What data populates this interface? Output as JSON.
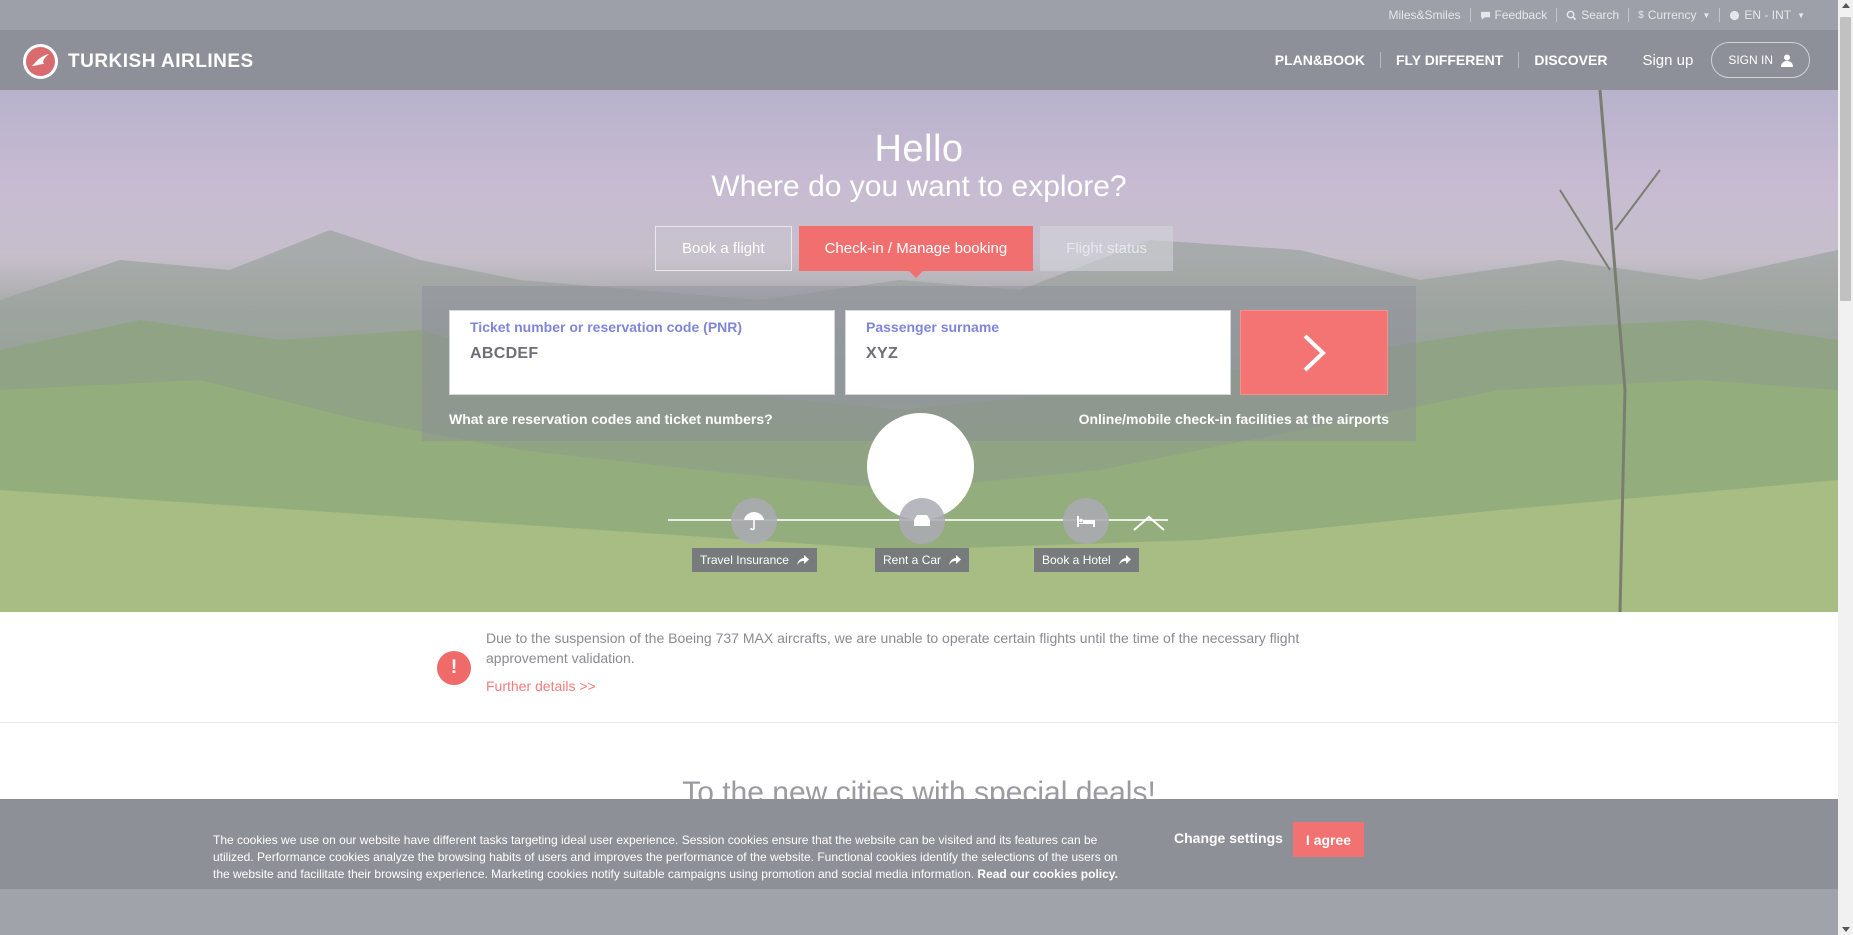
{
  "utility_bar": {
    "miles": "Miles&Smiles",
    "feedback": "Feedback",
    "search": "Search",
    "currency": "Currency",
    "language": "EN - INT"
  },
  "header": {
    "brand": "TURKISH AIRLINES",
    "nav": [
      "PLAN&BOOK",
      "FLY DIFFERENT",
      "DISCOVER"
    ],
    "signup": "Sign up",
    "signin": "SIGN IN"
  },
  "hero": {
    "title": "Hello",
    "subtitle": "Where do you want to explore?",
    "tabs": {
      "book": "Book a flight",
      "checkin": "Check-in / Manage booking",
      "status": "Flight status"
    },
    "active_tab": "checkin",
    "form": {
      "pnr_label": "Ticket number or reservation code (PNR)",
      "pnr_value": "ABCDEF",
      "surname_label": "Passenger surname",
      "surname_value": "XYZ"
    },
    "help_left": "What are reservation codes and ticket numbers?",
    "help_right": "Online/mobile check-in facilities at the airports",
    "services": {
      "insurance": "Travel Insurance",
      "car": "Rent a Car",
      "hotel": "Book a Hotel"
    }
  },
  "notice": {
    "icon": "!",
    "text": "Due to the suspension of the Boeing 737 MAX aircrafts, we are unable to operate certain flights until the time of the necessary flight approvement validation.",
    "link": "Further details >>"
  },
  "section_title": "To the new cities with special deals!",
  "cookie": {
    "text": "The cookies we use on our website have different tasks targeting ideal user experience. Session cookies ensure that the website can be visited and its features can be utilized. Performance cookies analyze the browsing habits of users and improves the performance of the website. Functional cookies identify the selections of the users on the website and facilitate their browsing experience. Marketing cookies notify suitable campaigns using promotion and social media information.",
    "policy_link": "Read our cookies policy.",
    "change_settings": "Change settings",
    "agree": "I agree"
  },
  "colors": {
    "brand_red": "#f26f6f",
    "field_label": "#7f86d9",
    "overlay": "#8e9098"
  }
}
